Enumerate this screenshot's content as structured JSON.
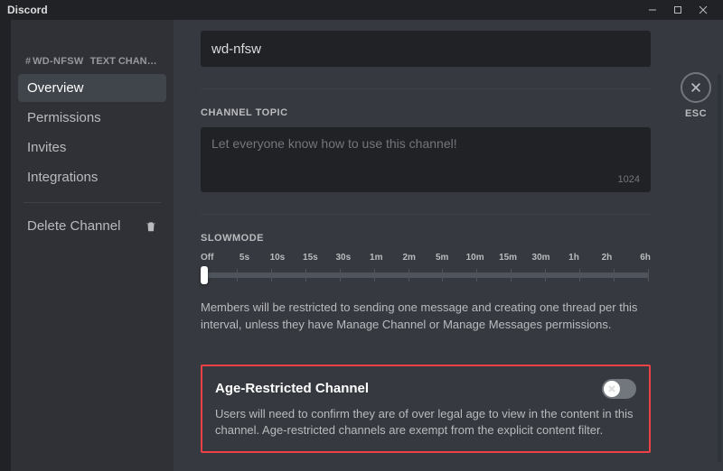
{
  "titlebar": {
    "brand": "Discord"
  },
  "esc": {
    "label": "ESC"
  },
  "sidebar": {
    "hash": "#",
    "channel_name": "WD-NFSW",
    "header_suffix": "TEXT CHANNE...",
    "items": [
      {
        "label": "Overview"
      },
      {
        "label": "Permissions"
      },
      {
        "label": "Invites"
      },
      {
        "label": "Integrations"
      }
    ],
    "delete_label": "Delete Channel"
  },
  "channel_name_input": {
    "value": "wd-nfsw"
  },
  "topic": {
    "label": "CHANNEL TOPIC",
    "placeholder": "Let everyone know how to use this channel!",
    "count": "1024"
  },
  "slowmode": {
    "label": "SLOWMODE",
    "ticks": [
      "Off",
      "5s",
      "10s",
      "15s",
      "30s",
      "1m",
      "2m",
      "5m",
      "10m",
      "15m",
      "30m",
      "1h",
      "2h",
      "6h"
    ],
    "description": "Members will be restricted to sending one message and creating one thread per this interval, unless they have Manage Channel or Manage Messages permissions."
  },
  "age": {
    "title": "Age-Restricted Channel",
    "description": "Users will need to confirm they are of over legal age to view in the content in this channel. Age-restricted channels are exempt from the explicit content filter.",
    "enabled": false
  }
}
